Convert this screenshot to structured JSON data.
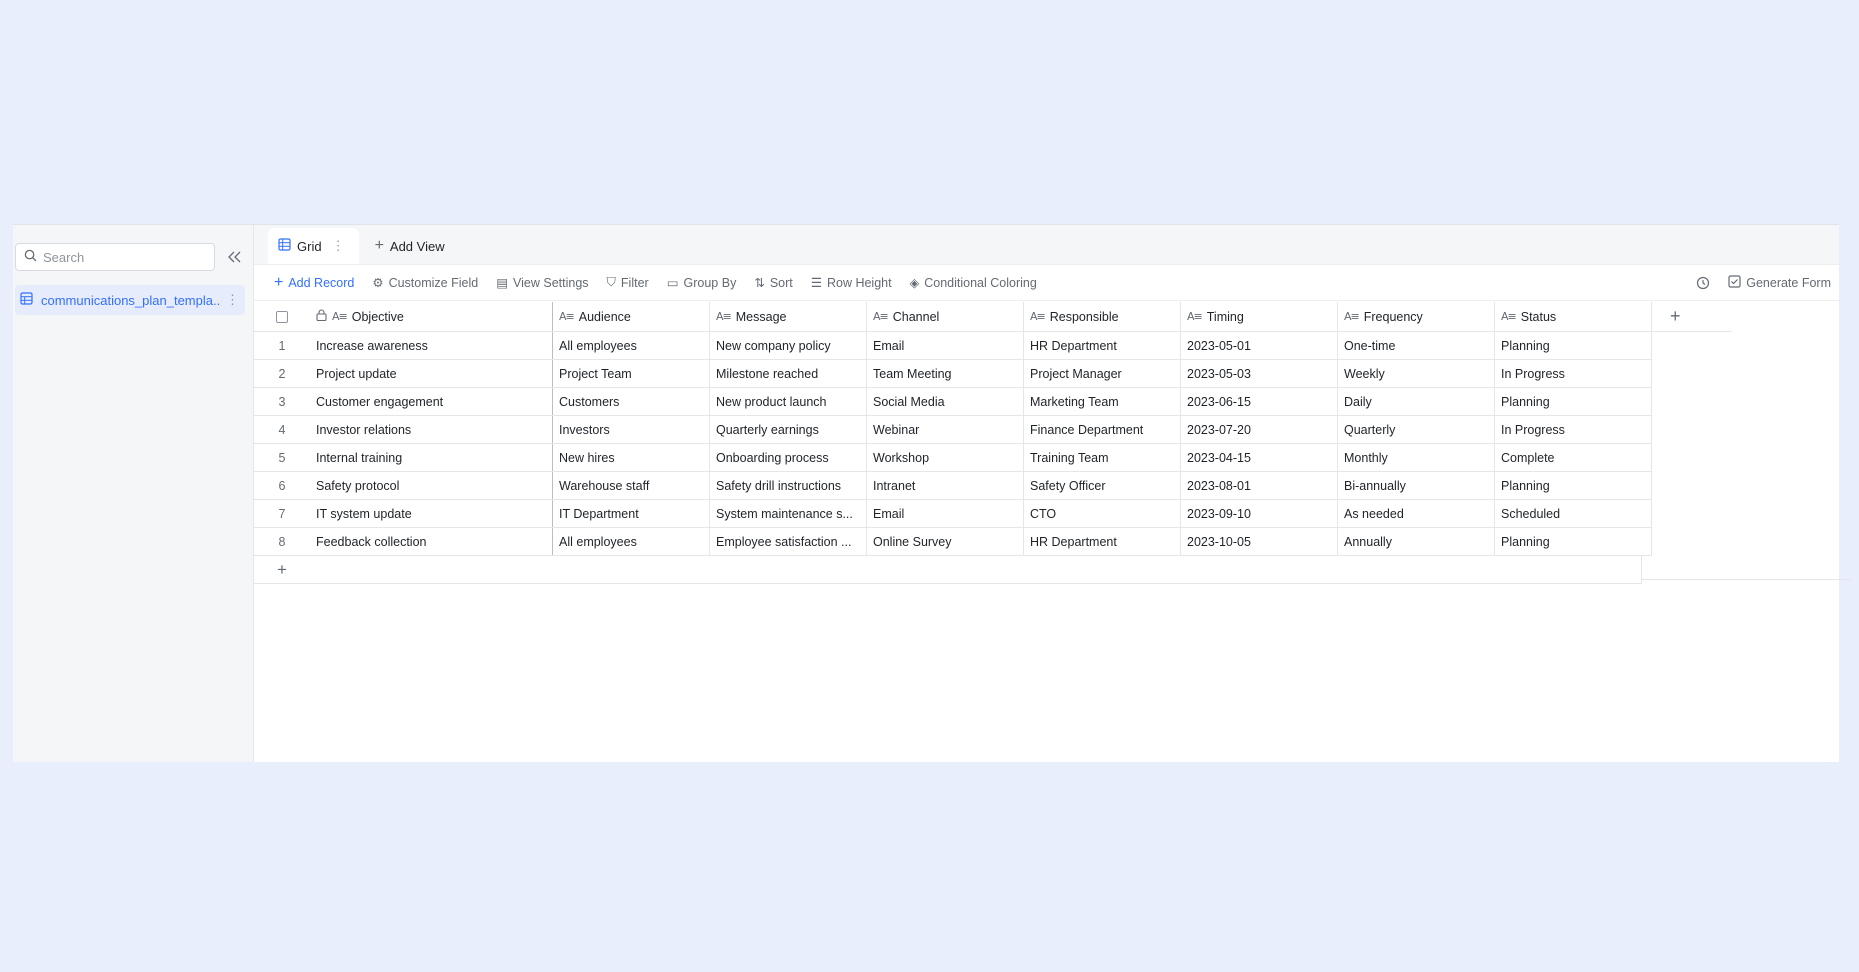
{
  "sidebar": {
    "search_placeholder": "Search",
    "collapse_icon": "double-chevron-left-icon",
    "tables": [
      {
        "label": "communications_plan_templa...",
        "icon": "table-icon"
      }
    ]
  },
  "tabs": [
    {
      "label": "Grid",
      "icon": "grid-icon"
    }
  ],
  "add_view_label": "Add View",
  "toolbar": {
    "add_record": "Add Record",
    "customize_field": "Customize Field",
    "view_settings": "View Settings",
    "filter": "Filter",
    "group_by": "Group By",
    "sort": "Sort",
    "row_height": "Row Height",
    "conditional_coloring": "Conditional Coloring",
    "generate_form": "Generate Form"
  },
  "columns": [
    "Objective",
    "Audience",
    "Message",
    "Channel",
    "Responsible",
    "Timing",
    "Frequency",
    "Status"
  ],
  "rows": [
    {
      "n": "1",
      "cells": [
        "Increase awareness",
        "All employees",
        "New company policy",
        "Email",
        "HR Department",
        "2023-05-01",
        "One-time",
        "Planning"
      ]
    },
    {
      "n": "2",
      "cells": [
        "Project update",
        "Project Team",
        "Milestone reached",
        "Team Meeting",
        "Project Manager",
        "2023-05-03",
        "Weekly",
        "In Progress"
      ]
    },
    {
      "n": "3",
      "cells": [
        "Customer engagement",
        "Customers",
        "New product launch",
        "Social Media",
        "Marketing Team",
        "2023-06-15",
        "Daily",
        "Planning"
      ]
    },
    {
      "n": "4",
      "cells": [
        "Investor relations",
        "Investors",
        "Quarterly earnings",
        "Webinar",
        "Finance Department",
        "2023-07-20",
        "Quarterly",
        "In Progress"
      ]
    },
    {
      "n": "5",
      "cells": [
        "Internal training",
        "New hires",
        "Onboarding process",
        "Workshop",
        "Training Team",
        "2023-04-15",
        "Monthly",
        "Complete"
      ]
    },
    {
      "n": "6",
      "cells": [
        "Safety protocol",
        "Warehouse staff",
        "Safety drill instructions",
        "Intranet",
        "Safety Officer",
        "2023-08-01",
        "Bi-annually",
        "Planning"
      ]
    },
    {
      "n": "7",
      "cells": [
        "IT system update",
        "IT Department",
        "System maintenance s...",
        "Email",
        "CTO",
        "2023-09-10",
        "As needed",
        "Scheduled"
      ]
    },
    {
      "n": "8",
      "cells": [
        "Feedback collection",
        "All employees",
        "Employee satisfaction ...",
        "Online Survey",
        "HR Department",
        "2023-10-05",
        "Annually",
        "Planning"
      ]
    }
  ]
}
